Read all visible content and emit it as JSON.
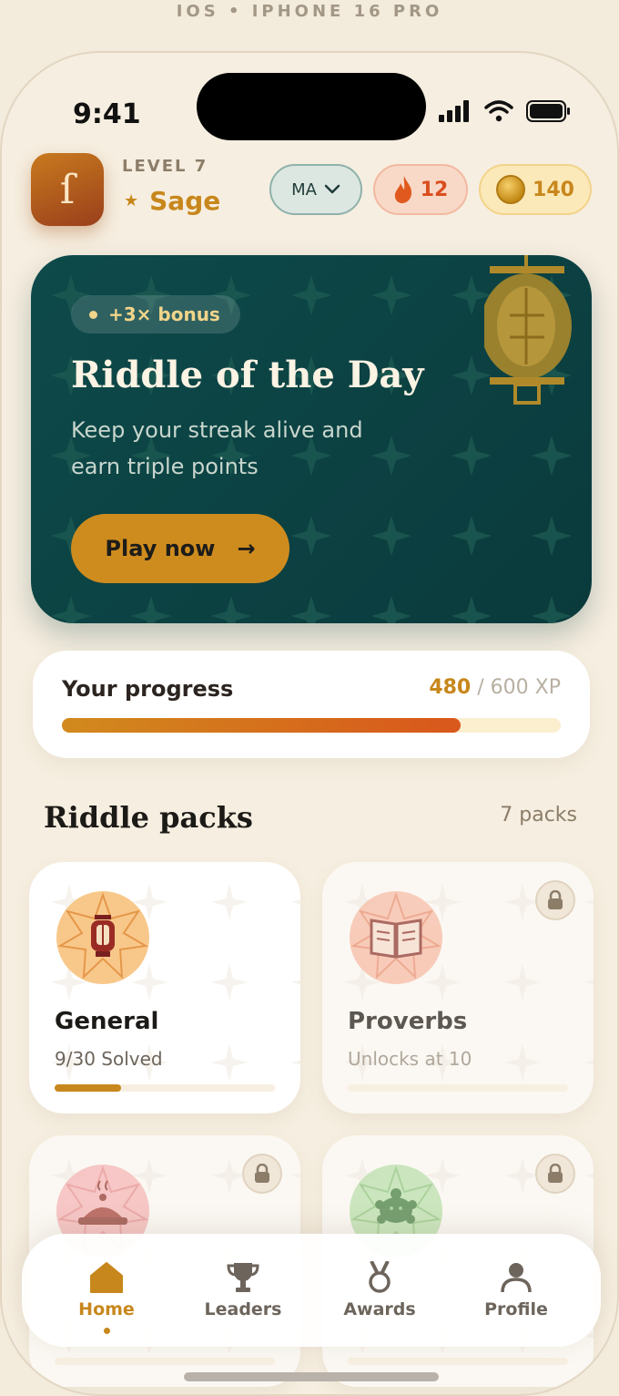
{
  "device_label": "IOS • IPHONE 16 PRO",
  "status_bar": {
    "time": "9:41"
  },
  "header": {
    "logo_letter": "ſ",
    "level_label": "LEVEL 7",
    "level_star": "★",
    "level_name": "Sage",
    "language": "MA",
    "streak": "12",
    "coins": "140"
  },
  "hero": {
    "badge": "+3× bonus",
    "title": "Riddle of the Day",
    "subtitle": "Keep your streak alive and earn triple points",
    "cta": "Play now",
    "cta_icon": "→"
  },
  "progress": {
    "title": "Your progress",
    "current": "480",
    "separator": "/",
    "total": "600 XP",
    "fraction": 0.8
  },
  "packs_section": {
    "title": "Riddle packs",
    "count": "7 packs",
    "packs": [
      {
        "name": "General",
        "status": "9/30 Solved",
        "progress": 0.3,
        "locked": false,
        "icon": "lantern-icon",
        "color": "#f8c88a"
      },
      {
        "name": "Proverbs",
        "status": "Unlocks at 10",
        "progress": 0,
        "locked": true,
        "icon": "book-icon",
        "color": "#f7b9a1"
      },
      {
        "name": "",
        "status": "",
        "progress": 0,
        "locked": true,
        "icon": "tagine-icon",
        "color": "#f4b3b2"
      },
      {
        "name": "",
        "status": "",
        "progress": 0,
        "locked": true,
        "icon": "turtle-icon",
        "color": "#b7dfa8"
      }
    ]
  },
  "tabbar": {
    "tabs": [
      {
        "label": "Home",
        "icon": "home-icon",
        "active": true
      },
      {
        "label": "Leaders",
        "icon": "trophy-icon",
        "active": false
      },
      {
        "label": "Awards",
        "icon": "medal-icon",
        "active": false
      },
      {
        "label": "Profile",
        "icon": "person-icon",
        "active": false
      }
    ]
  },
  "colors": {
    "accent": "#c8871c",
    "hero_bg": "#0e4a4a",
    "streak": "#d94e1f",
    "page_bg": "#f6eee0"
  }
}
